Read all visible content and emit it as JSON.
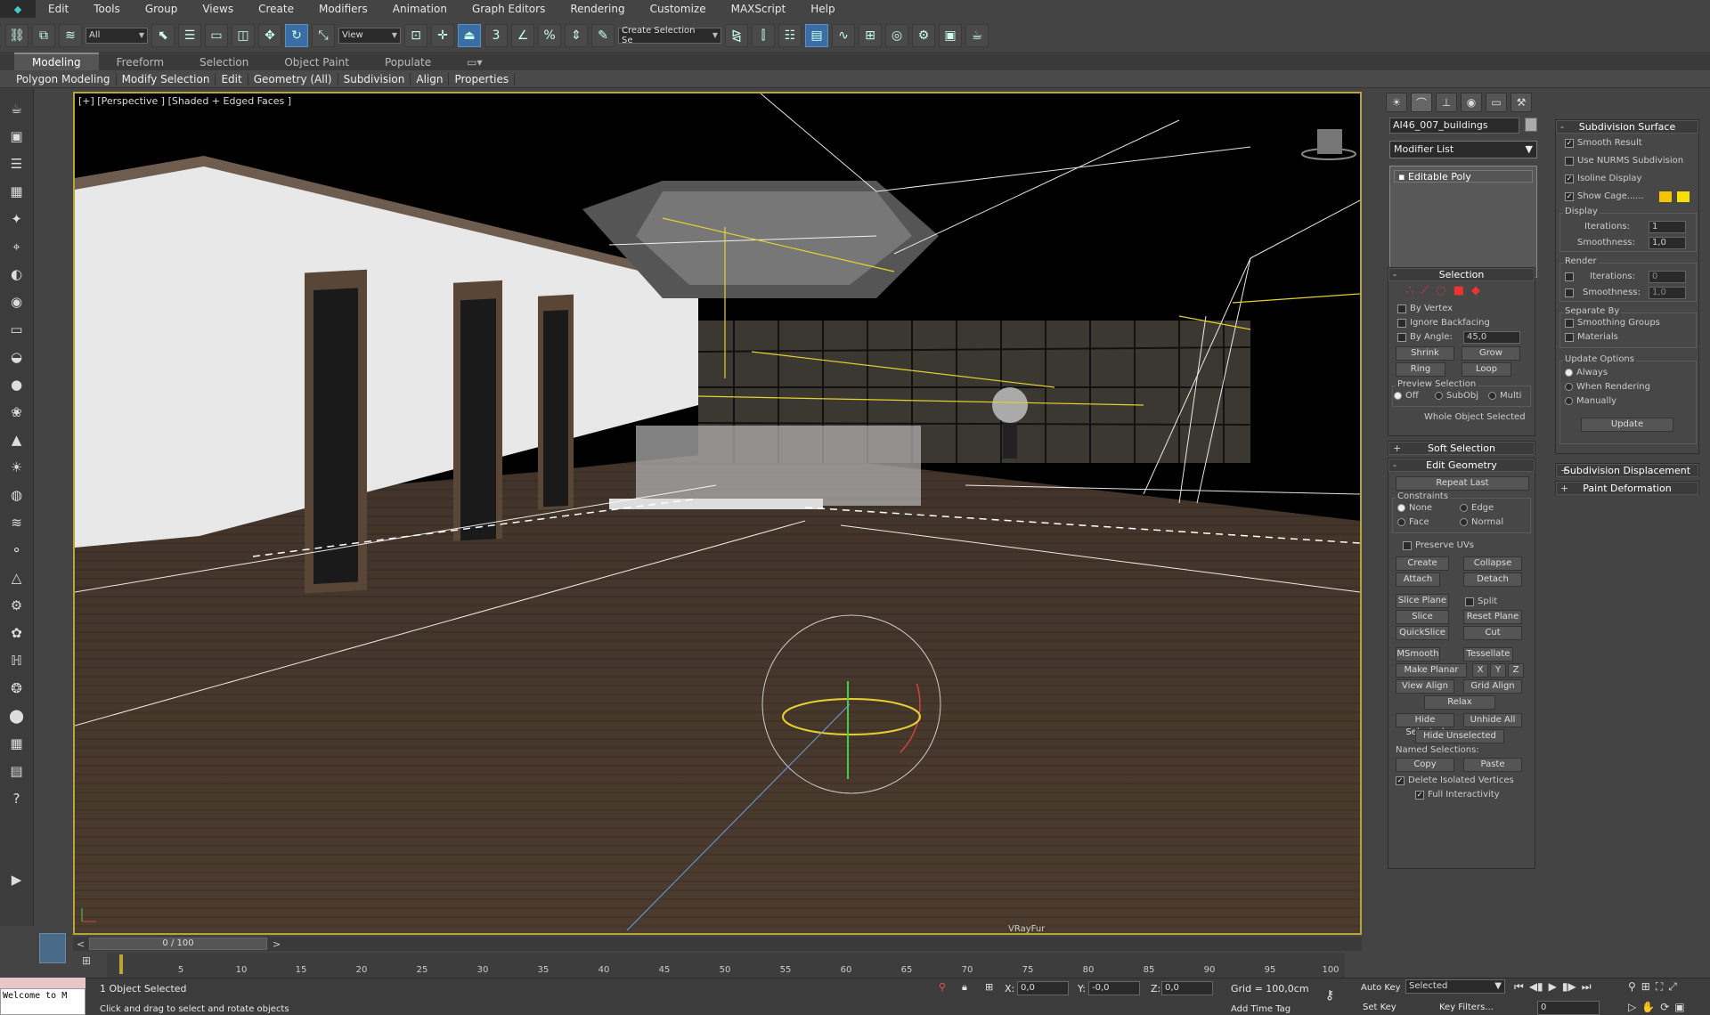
{
  "menu": [
    "Edit",
    "Tools",
    "Group",
    "Views",
    "Create",
    "Modifiers",
    "Animation",
    "Graph Editors",
    "Rendering",
    "Customize",
    "MAXScript",
    "Help"
  ],
  "toolbar": {
    "filter": "All",
    "refcoord": "View",
    "selset": "Create Selection Se",
    "snap_label": "3",
    "angle_label": "%"
  },
  "ribbon": {
    "tabs": [
      "Modeling",
      "Freeform",
      "Selection",
      "Object Paint",
      "Populate"
    ],
    "sub": [
      "Polygon Modeling",
      "Modify Selection",
      "Edit",
      "Geometry (All)",
      "Subdivision",
      "Align",
      "Properties"
    ]
  },
  "viewport": {
    "label": "[+] [Perspective ] [Shaded + Edged Faces ]",
    "bottom_text": "VRayFur"
  },
  "timeline": {
    "slider": "0 / 100",
    "ticks": [
      "5",
      "10",
      "15",
      "20",
      "25",
      "30",
      "35",
      "40",
      "45",
      "50",
      "55",
      "60",
      "65",
      "70",
      "75",
      "80",
      "85",
      "90",
      "95",
      "100"
    ]
  },
  "status": {
    "command_text": "Welcome to M",
    "selected": "1 Object Selected",
    "prompt": "Click and drag to select and rotate objects",
    "x_label": "X:",
    "x": "0,0",
    "y_label": "Y:",
    "y": "-0,0",
    "z_label": "Z:",
    "z": "0,0",
    "grid": "Grid = 100,0cm",
    "add_time_tag": "Add Time Tag",
    "auto_key": "Auto Key",
    "set_key": "Set Key",
    "key_mode": "Selected",
    "key_filters": "Key Filters...",
    "frame": "0"
  },
  "panel": {
    "object_name": "AI46_007_buildings",
    "modifier_list": "Modifier List",
    "stack_item": "Editable Poly",
    "selection": {
      "title": "Selection",
      "by_vertex": "By Vertex",
      "ignore_backfacing": "Ignore Backfacing",
      "by_angle": "By Angle:",
      "angle": "45,0",
      "shrink": "Shrink",
      "grow": "Grow",
      "ring": "Ring",
      "loop": "Loop",
      "preview": "Preview Selection",
      "off": "Off",
      "subobj": "SubObj",
      "multi": "Multi",
      "whole": "Whole Object Selected"
    },
    "soft_selection": "Soft Selection",
    "edit_geometry": {
      "title": "Edit Geometry",
      "repeat_last": "Repeat Last",
      "constraints": "Constraints",
      "none": "None",
      "edge": "Edge",
      "face": "Face",
      "normal": "Normal",
      "preserve_uvs": "Preserve UVs",
      "create": "Create",
      "collapse": "Collapse",
      "attach": "Attach",
      "detach": "Detach",
      "slice_plane": "Slice Plane",
      "split": "Split",
      "slice": "Slice",
      "reset_plane": "Reset Plane",
      "quickslice": "QuickSlice",
      "cut": "Cut",
      "msmooth": "MSmooth",
      "tessellate": "Tessellate",
      "make_planar": "Make Planar",
      "x": "X",
      "y": "Y",
      "z": "Z",
      "view_align": "View Align",
      "grid_align": "Grid Align",
      "relax": "Relax",
      "hide_selected": "Hide Selected",
      "unhide_all": "Unhide All",
      "hide_unselected": "Hide Unselected",
      "named_sel": "Named Selections:",
      "copy": "Copy",
      "paste": "Paste",
      "delete_isolated": "Delete Isolated Vertices",
      "full_interactivity": "Full Interactivity"
    },
    "subdivision_surface": {
      "title": "Subdivision Surface",
      "smooth_result": "Smooth Result",
      "use_nurms": "Use NURMS Subdivision",
      "isoline": "Isoline Display",
      "show_cage": "Show Cage......",
      "display": "Display",
      "iterations": "Iterations:",
      "iter_val": "1",
      "smoothness": "Smoothness:",
      "smooth_val": "1,0",
      "render": "Render",
      "r_iter_val": "0",
      "r_smooth_val": "1,0",
      "separate_by": "Separate By",
      "smoothing_groups": "Smoothing Groups",
      "materials": "Materials",
      "update_options": "Update Options",
      "always": "Always",
      "when_rendering": "When Rendering",
      "manually": "Manually",
      "update": "Update"
    },
    "subdivision_displacement": "Subdivision Displacement",
    "paint_deformation": "Paint Deformation",
    "cage_colors": [
      "#f5c400",
      "#f5e000"
    ]
  }
}
